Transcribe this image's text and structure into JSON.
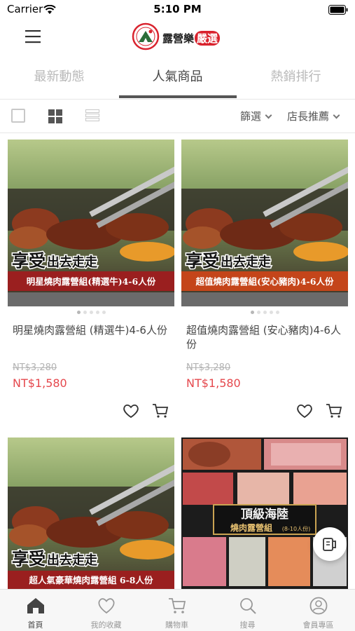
{
  "status_bar": {
    "carrier": "Carrier",
    "time": "5:10 PM"
  },
  "header": {
    "logo_text": "露營樂",
    "logo_badge": "嚴選",
    "menu_icon": "hamburger-icon"
  },
  "tabs": [
    {
      "label": "最新動態",
      "active": false
    },
    {
      "label": "人氣商品",
      "active": true
    },
    {
      "label": "熱銷排行",
      "active": false
    }
  ],
  "filter_bar": {
    "filter_label": "篩選",
    "sort_label": "店長推薦",
    "view_mode": "grid"
  },
  "products": [
    {
      "name": "明星燒肉露營組 (精選牛)4-6人份",
      "old_price": "NT$3,280",
      "price": "NT$1,580",
      "banner_slogan_a": "享受",
      "banner_slogan_b": "出去走走",
      "banner_caption": "明星燒肉露營組(精選牛)4-6人份",
      "banner_color": "#9a1f1f"
    },
    {
      "name": "超值燒肉露營組 (安心豬肉)4-6人份",
      "old_price": "NT$3,280",
      "price": "NT$1,580",
      "banner_slogan_a": "享受",
      "banner_slogan_b": "出去走走",
      "banner_caption": "超值燒肉露營組(安心豬肉)4-6人份",
      "banner_color": "#c4451a"
    },
    {
      "banner_slogan_a": "享受",
      "banner_slogan_b": "出去走走",
      "banner_caption": "超人氣豪華燒肉露營組 6-8人份",
      "banner_color": "#9a1f1f"
    },
    {
      "banner_title": "頂級海陸",
      "banner_subtitle": "燒肉露營組",
      "banner_serving": "(8-10人份)"
    }
  ],
  "bottom_nav": [
    {
      "label": "首頁",
      "icon": "home-icon",
      "active": true
    },
    {
      "label": "我的收藏",
      "icon": "heart-icon",
      "active": false
    },
    {
      "label": "購物車",
      "icon": "cart-icon",
      "active": false
    },
    {
      "label": "搜尋",
      "icon": "search-icon",
      "active": false
    },
    {
      "label": "會員專區",
      "icon": "user-icon",
      "active": false
    }
  ],
  "colors": {
    "accent_red": "#e5484d",
    "active_tab": "#555555",
    "logo_red": "#d9232e"
  }
}
